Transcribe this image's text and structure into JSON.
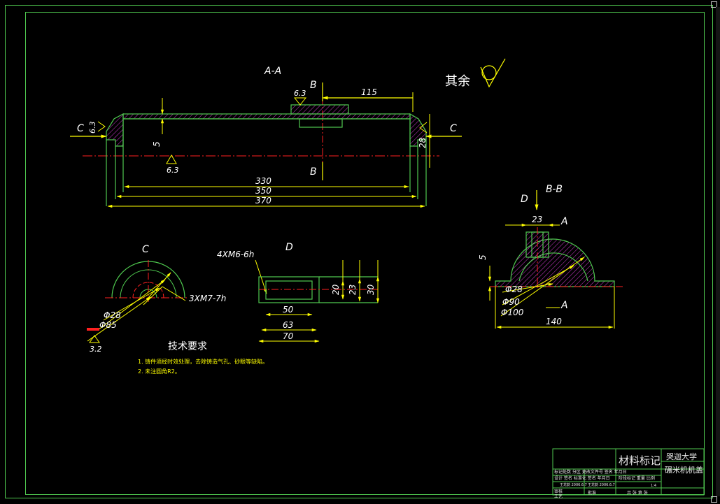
{
  "views": {
    "section_aa": {
      "title": "A-A",
      "cut_marks": [
        "B",
        "B",
        "C",
        "C"
      ],
      "dims": {
        "d115": "115",
        "d330": "330",
        "d350": "350",
        "d370": "370",
        "d5": "5",
        "d28": "28"
      },
      "roughness": [
        "6.3",
        "6.3",
        "6.3"
      ]
    },
    "general_roughness": {
      "label": "其余"
    },
    "view_c": {
      "title": "C",
      "thread": "3XM7-7h",
      "d28": "Φ28",
      "d85": "Φ85",
      "roughness": "3.2"
    },
    "view_d": {
      "title": "D",
      "thread": "4XM6-6h",
      "dims": {
        "d50": "50",
        "d63": "63",
        "d70": "70",
        "d20": "20",
        "d23": "23",
        "d30": "30"
      }
    },
    "section_bb": {
      "title": "B-B",
      "view_label": "D",
      "ref_a1": "A",
      "ref_a2": "A",
      "dims": {
        "d23": "23",
        "d5": "5",
        "d28": "Φ28",
        "d90": "Φ90",
        "d100": "Φ100",
        "d140": "140"
      }
    },
    "tech_req": {
      "title": "技术要求",
      "items": [
        "1. 铸件须经时效处理，去除铸造气孔、砂眼等缺陷。",
        "2. 未注圆角R2。"
      ]
    }
  },
  "title_block": {
    "material": "材料标记",
    "school": "哭迦大学",
    "part_name": "碾米机机盖",
    "row1": "标记处数  分区  更改文件号  签名  年月日",
    "row2": "设计  签名  标准化  签名  年月日",
    "designer": "王龙韵  2006.6.7",
    "checker": "王龙韵  2006.6.7",
    "stage": "阶段标记  重量  比例",
    "scale": "1:4",
    "audit": "审核",
    "process": "工艺",
    "approve": "批准",
    "sheets": "共  张   第  张"
  },
  "colors": {
    "frame": "#4fc94f",
    "part": "#4fc94f",
    "dimension": "#ffff00",
    "centerline": "#ff2020",
    "hatch": "#d03cd0",
    "text": "#ffffff"
  }
}
